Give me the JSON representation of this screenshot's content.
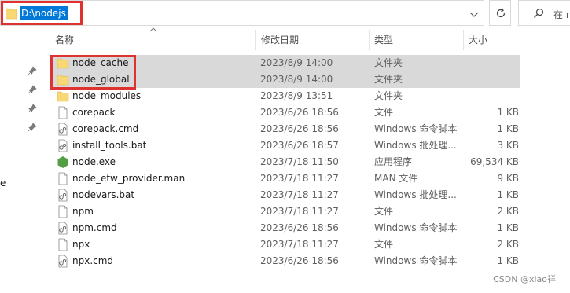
{
  "address_bar": {
    "path": "D:\\nodejs"
  },
  "search": {
    "placeholder_fragment": "在 r"
  },
  "nav": {
    "fragment": "e"
  },
  "columns": {
    "name": "名称",
    "modified": "修改日期",
    "type": "类型",
    "size": "大小"
  },
  "files": [
    {
      "name": "node_cache",
      "modified": "2023/8/9 14:00",
      "type": "文件夹",
      "size": "",
      "icon": "folder-icon",
      "selected": true
    },
    {
      "name": "node_global",
      "modified": "2023/8/9 14:00",
      "type": "文件夹",
      "size": "",
      "icon": "folder-icon",
      "selected": true
    },
    {
      "name": "node_modules",
      "modified": "2023/8/9 13:51",
      "type": "文件夹",
      "size": "",
      "icon": "folder-icon",
      "selected": false
    },
    {
      "name": "corepack",
      "modified": "2023/6/26 18:56",
      "type": "文件",
      "size": "1 KB",
      "icon": "file-icon",
      "selected": false
    },
    {
      "name": "corepack.cmd",
      "modified": "2023/6/26 18:56",
      "type": "Windows 命令脚本",
      "size": "1 KB",
      "icon": "script-icon",
      "selected": false
    },
    {
      "name": "install_tools.bat",
      "modified": "2023/6/26 18:57",
      "type": "Windows 批处理...",
      "size": "3 KB",
      "icon": "script-icon",
      "selected": false
    },
    {
      "name": "node.exe",
      "modified": "2023/7/18 11:50",
      "type": "应用程序",
      "size": "69,534 KB",
      "icon": "node-exe-icon",
      "selected": false
    },
    {
      "name": "node_etw_provider.man",
      "modified": "2023/7/18 11:27",
      "type": "MAN 文件",
      "size": "9 KB",
      "icon": "file-icon",
      "selected": false
    },
    {
      "name": "nodevars.bat",
      "modified": "2023/7/18 11:27",
      "type": "Windows 批处理...",
      "size": "1 KB",
      "icon": "script-icon",
      "selected": false
    },
    {
      "name": "npm",
      "modified": "2023/7/18 11:27",
      "type": "文件",
      "size": "2 KB",
      "icon": "file-icon",
      "selected": false
    },
    {
      "name": "npm.cmd",
      "modified": "2023/6/26 18:56",
      "type": "Windows 命令脚本",
      "size": "1 KB",
      "icon": "script-icon",
      "selected": false
    },
    {
      "name": "npx",
      "modified": "2023/7/18 11:27",
      "type": "文件",
      "size": "2 KB",
      "icon": "file-icon",
      "selected": false
    },
    {
      "name": "npx.cmd",
      "modified": "2023/6/26 18:56",
      "type": "Windows 命令脚本",
      "size": "1 KB",
      "icon": "script-icon",
      "selected": false
    }
  ],
  "watermark": "CSDN @xiao祥",
  "colors": {
    "selection": "#d9d9d9",
    "highlight_box": "#e03131",
    "address_selection": "#0078d7",
    "folder": "#f8d775",
    "node_green": "#539e43"
  }
}
